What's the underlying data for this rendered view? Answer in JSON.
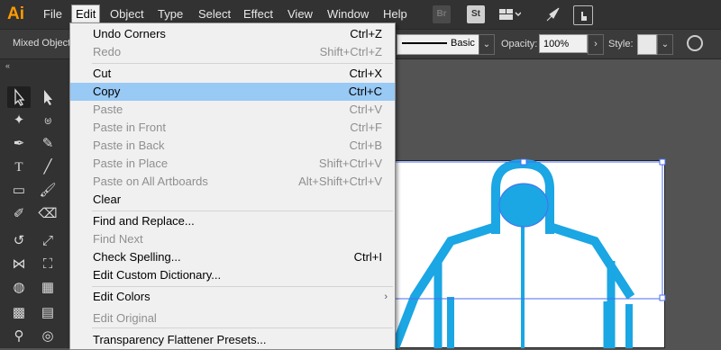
{
  "app": {
    "logo": "Ai"
  },
  "menubar": {
    "items": [
      "File",
      "Edit",
      "Object",
      "Type",
      "Select",
      "Effect",
      "View",
      "Window",
      "Help"
    ],
    "icons": {
      "bridge": "Br",
      "stock": "St"
    }
  },
  "controlbar": {
    "selection": "Mixed Objects",
    "stroke_profile": "Basic",
    "opacity_label": "Opacity:",
    "opacity_value": "100%",
    "style_label": "Style:"
  },
  "tools_panel": {
    "collapse": "«"
  },
  "edit_menu": {
    "items": [
      {
        "label": "Undo Corners",
        "shortcut": "Ctrl+Z",
        "disabled": false
      },
      {
        "label": "Redo",
        "shortcut": "Shift+Ctrl+Z",
        "disabled": true
      },
      {
        "label": "Cut",
        "shortcut": "Ctrl+X",
        "disabled": false
      },
      {
        "label": "Copy",
        "shortcut": "Ctrl+C",
        "disabled": false,
        "highlighted": true
      },
      {
        "label": "Paste",
        "shortcut": "Ctrl+V",
        "disabled": true
      },
      {
        "label": "Paste in Front",
        "shortcut": "Ctrl+F",
        "disabled": true
      },
      {
        "label": "Paste in Back",
        "shortcut": "Ctrl+B",
        "disabled": true
      },
      {
        "label": "Paste in Place",
        "shortcut": "Shift+Ctrl+V",
        "disabled": true
      },
      {
        "label": "Paste on All Artboards",
        "shortcut": "Alt+Shift+Ctrl+V",
        "disabled": true
      },
      {
        "label": "Clear",
        "shortcut": "",
        "disabled": false
      },
      {
        "label": "Find and Replace...",
        "shortcut": "",
        "disabled": false
      },
      {
        "label": "Find Next",
        "shortcut": "",
        "disabled": true
      },
      {
        "label": "Check Spelling...",
        "shortcut": "Ctrl+I",
        "disabled": false
      },
      {
        "label": "Edit Custom Dictionary...",
        "shortcut": "",
        "disabled": false
      },
      {
        "label": "Edit Colors",
        "shortcut": "",
        "disabled": false,
        "submenu": true
      },
      {
        "label": "Edit Original",
        "shortcut": "",
        "disabled": true
      },
      {
        "label": "Transparency Flattener Presets...",
        "shortcut": "",
        "disabled": false
      }
    ]
  },
  "colors": {
    "accent": "#99c9f5",
    "artwork": "#1ba6e4",
    "logo": "#ff9a00"
  }
}
